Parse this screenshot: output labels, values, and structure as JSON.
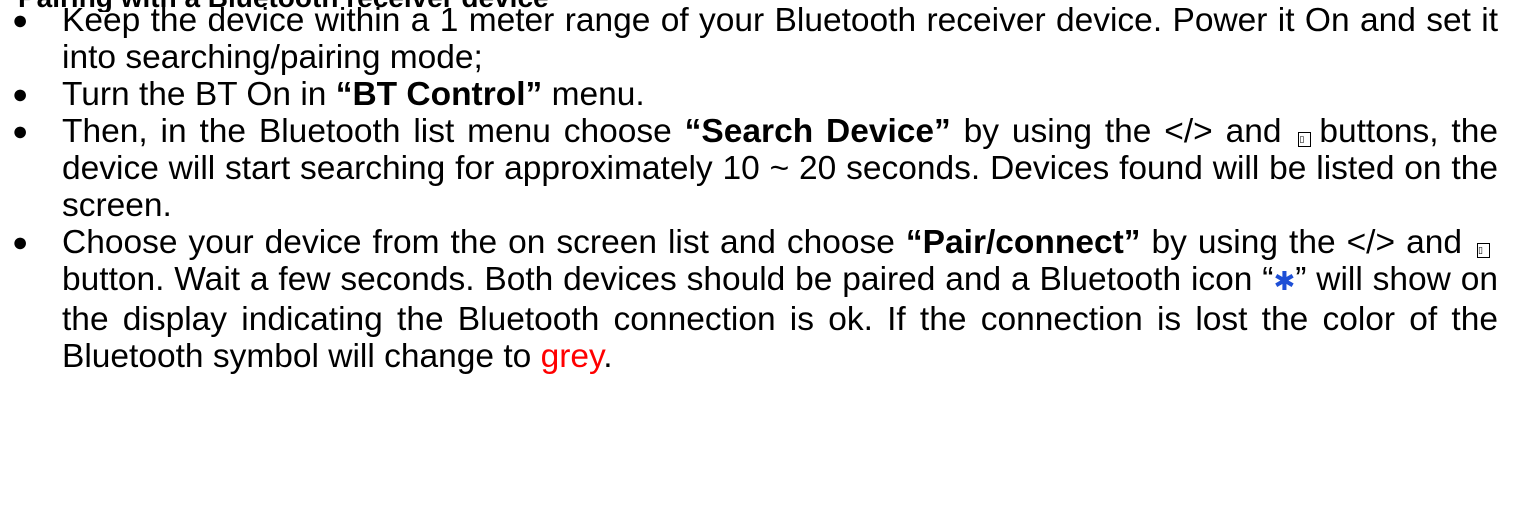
{
  "heading_fragment": "Pairing with a Bluetooth receiver device",
  "bullet_glyph": "●",
  "list": {
    "item1": {
      "text": "Keep the device within a 1 meter range of your Bluetooth receiver device. Power it On and set it into searching/pairing mode;"
    },
    "item2": {
      "text_a": "Turn the BT On in ",
      "bold": "“BT Control”",
      "text_b": " menu."
    },
    "item3": {
      "text_a": "Then, in the Bluetooth list menu choose ",
      "bold": "“Search Device”",
      "text_b": " by using the </> and",
      "text_c": "buttons, the device will start searching for approximately 10 ~ 20 seconds. Devices found will be listed on the screen."
    },
    "item4": {
      "text_a": "Choose your device from the on screen list and choose ",
      "bold": "“Pair/connect”",
      "text_b": " by using the </> and",
      "text_c": "button. Wait a few seconds. Both devices should be paired and a Bluetooth icon “",
      "text_d": "” will show on the display indicating the Bluetooth connection is ok. If the connection is lost the color of the Bluetooth symbol will change to ",
      "red_word": "grey",
      "text_e": "."
    }
  },
  "icons": {
    "button_icon": "ok-button-icon",
    "button_glyph": "▯",
    "bluetooth_icon": "bluetooth-icon",
    "bluetooth_glyph": "✱"
  },
  "colors": {
    "text": "#000000",
    "red": "#ff0000",
    "bluetooth_blue": "#1e4fd6"
  }
}
